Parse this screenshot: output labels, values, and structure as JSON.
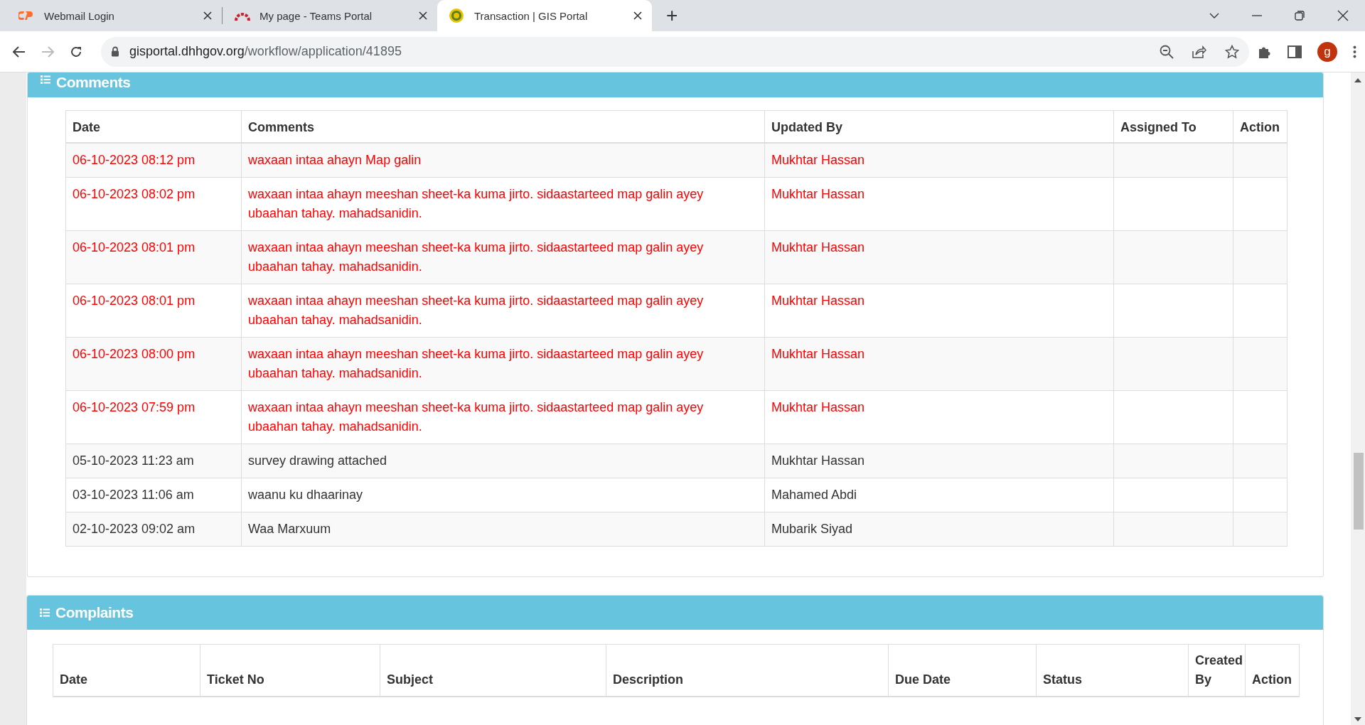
{
  "browser": {
    "tabs": [
      {
        "title": "Webmail Login",
        "selected": false
      },
      {
        "title": "My page - Teams Portal",
        "selected": false
      },
      {
        "title": "Transaction | GIS Portal",
        "selected": true
      }
    ],
    "new_tab": "+",
    "address": {
      "host": "gisportal.dhhgov.org",
      "path": "/workflow/application/41895"
    },
    "profile": "g"
  },
  "comments": {
    "title": "Comments",
    "columns": [
      "Date",
      "Comments",
      "Updated By",
      "Assigned To",
      "Action"
    ],
    "rows": [
      {
        "date": "06-10-2023 08:12 pm",
        "comment": "waxaan intaa ahayn Map galin",
        "updated_by": "Mukhtar Hassan",
        "color": "#ff0000"
      },
      {
        "date": "06-10-2023 08:02 pm",
        "comment": "waxaan intaa ahayn meeshan sheet-ka kuma jirto. sidaastarteed map galin ayey ubaahan tahay. mahadsanidin.",
        "updated_by": "Mukhtar Hassan",
        "color": "#ff0000"
      },
      {
        "date": "06-10-2023 08:01 pm",
        "comment": "waxaan intaa ahayn meeshan sheet-ka kuma jirto. sidaastarteed map galin ayey ubaahan tahay. mahadsanidin.",
        "updated_by": "Mukhtar Hassan",
        "color": "#ff0000"
      },
      {
        "date": "06-10-2023 08:01 pm",
        "comment": "waxaan intaa ahayn meeshan sheet-ka kuma jirto. sidaastarteed map galin ayey ubaahan tahay. mahadsanidin.",
        "updated_by": "Mukhtar Hassan",
        "color": "#ff0000"
      },
      {
        "date": "06-10-2023 08:00 pm",
        "comment": "waxaan intaa ahayn meeshan sheet-ka kuma jirto. sidaastarteed map galin ayey ubaahan tahay. mahadsanidin.",
        "updated_by": "Mukhtar Hassan",
        "color": "#ff0000"
      },
      {
        "date": "06-10-2023 07:59 pm",
        "comment": "waxaan intaa ahayn meeshan sheet-ka kuma jirto. sidaastarteed map galin ayey ubaahan tahay. mahadsanidin.",
        "updated_by": "Mukhtar Hassan",
        "color": "#ff0000"
      },
      {
        "date": "05-10-2023 11:23 am",
        "comment": "survey drawing attached",
        "updated_by": "Mukhtar Hassan",
        "color": "#333333"
      },
      {
        "date": "03-10-2023 11:06 am",
        "comment": "waanu ku dhaarinay",
        "updated_by": "Mahamed Abdi",
        "color": "#333333"
      },
      {
        "date": "02-10-2023 09:02 am",
        "comment": "Waa Marxuum",
        "updated_by": "Mubarik Siyad",
        "color": "#333333"
      }
    ]
  },
  "complaints": {
    "title": "Complaints",
    "columns": [
      "Date",
      "Ticket No",
      "Subject",
      "Description",
      "Due Date",
      "Status",
      "Created By",
      "Action"
    ]
  }
}
